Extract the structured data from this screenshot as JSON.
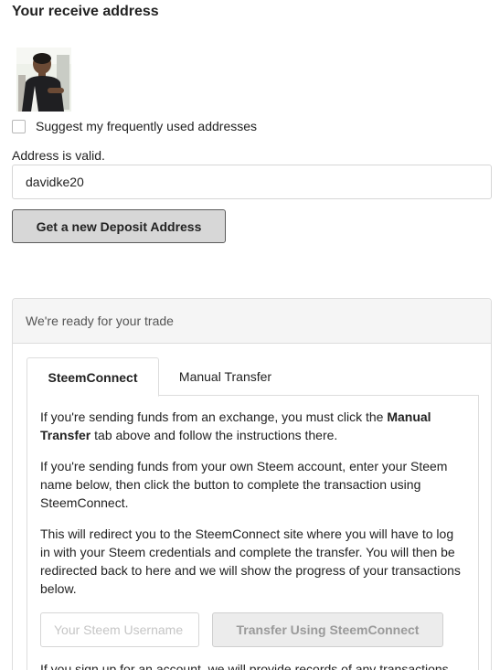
{
  "receive": {
    "title": "Your receive address",
    "suggest_label": "Suggest my frequently used addresses",
    "valid_message": "Address is valid.",
    "address_value": "davidke20",
    "deposit_button": "Get a new Deposit Address"
  },
  "trade_panel": {
    "heading": "We're ready for your trade",
    "tabs": [
      {
        "label": "SteemConnect",
        "active": true
      },
      {
        "label": "Manual Transfer",
        "active": false
      }
    ],
    "para1_before": "If you're sending funds from an exchange, you must click the ",
    "para1_bold": "Manual Transfer",
    "para1_after": " tab above and follow the instructions there.",
    "para2": "If you're sending funds from your own Steem account, enter your Steem name below, then click the button to complete the transaction using SteemConnect.",
    "para3": "This will redirect you to the SteemConnect site where you will have to log in with your Steem credentials and complete the transfer. You will then be redirected back to here and we will show the progress of your transactions below.",
    "username_placeholder": "Your Steem Username",
    "transfer_button": "Transfer Using SteemConnect",
    "para4": "If you sign up for an account, we will provide records of any transactions"
  }
}
